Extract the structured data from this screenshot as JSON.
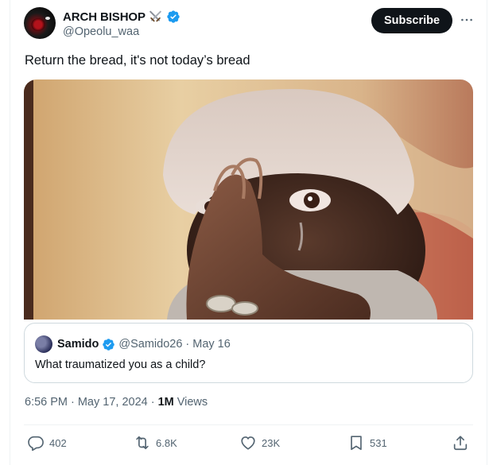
{
  "author": {
    "display_name": "ARCH BISHOP",
    "handle": "@Opeolu_waa"
  },
  "header": {
    "subscribe_label": "Subscribe",
    "more_glyph": "···"
  },
  "tweet": {
    "text": "Return the bread, it's not today’s bread"
  },
  "quote": {
    "name": "Samido",
    "handle": "@Samido26",
    "separator": "·",
    "date": "May 16",
    "text": "What traumatized you as a child?"
  },
  "meta": {
    "time": "6:56 PM",
    "dot1": "·",
    "date": "May 17, 2024",
    "dot2": "·",
    "views_count": "1M",
    "views_label": "Views"
  },
  "actions": {
    "replies": "402",
    "reposts": "6.8K",
    "likes": "23K",
    "bookmarks": "531"
  },
  "colors": {
    "verified": "#1d9bf0",
    "text_primary": "#0f1419",
    "text_secondary": "#536471",
    "button_dark": "#0f1419"
  },
  "icons": {
    "verified": "verified-badge-icon",
    "swords": "crossed-swords-icon",
    "reply": "reply-icon",
    "repost": "repost-icon",
    "like": "heart-icon",
    "bookmark": "bookmark-icon",
    "share": "share-icon",
    "more": "more-icon"
  }
}
